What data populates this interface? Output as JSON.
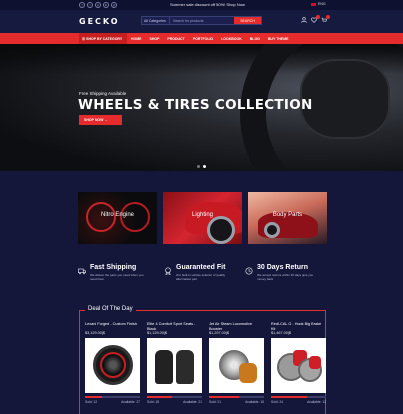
{
  "topbar": {
    "socials": [
      "f",
      "t",
      "p",
      "in",
      "yt"
    ],
    "promo": "Summer sale discount off 50%! Shop Now",
    "language": "ENG"
  },
  "header": {
    "logo": "GECKO",
    "search_category": "All Categories",
    "search_placeholder": "Search for products",
    "search_button": "SEARCH",
    "icons": [
      "user-icon",
      "heart-icon",
      "cart-icon"
    ]
  },
  "nav": {
    "shop_by_category": "☰ SHOP BY CATEGORY",
    "items": [
      "HOME",
      "SHOP",
      "PRODUCT",
      "PORTFOLIO",
      "LOOKBOOK",
      "BLOG",
      "BUY THEME"
    ]
  },
  "hero": {
    "subtitle": "Free Shipping Available",
    "title": "WHEELS & TIRES COLLECTION",
    "button": "SHOP NOW  →",
    "slides": 2,
    "active_slide": 1
  },
  "categories": [
    {
      "label": "Nitro Engine"
    },
    {
      "label": "Lighting"
    },
    {
      "label": "Body Parts"
    }
  ],
  "features": [
    {
      "icon": "truck-icon",
      "title": "Fast Shipping",
      "desc": "We deliver the parts you need when you need them."
    },
    {
      "icon": "badge-icon",
      "title": "Guaranteed Fit",
      "desc": "Our built-in vehicle selector of quality aftermarket part"
    },
    {
      "icon": "clock-icon",
      "title": "30 Days Return",
      "desc": "We accept returns within 30 days give you money back"
    }
  ],
  "deal": {
    "title": "Deal Of The Day",
    "products": [
      {
        "name": "Lexani Forged - Custom Finish",
        "price": "$3,129.00|$",
        "sold": "Sold: 12",
        "available": "Available: 27",
        "progress": 0.3
      },
      {
        "name": "Elite 4 Comfort Sport Seats - Black",
        "price": "$1,129.00|$",
        "sold": "Sold: 18",
        "available": "Available: 21",
        "progress": 0.45
      },
      {
        "name": "Jet Air Steam Locomotive Booster",
        "price": "$1,297.00|$",
        "sold": "Sold: 21",
        "available": "Available: 15",
        "progress": 0.55
      },
      {
        "name": "Redi-CAL G - Hook Big Brake Kit",
        "price": "$1,467.00|$",
        "sold": "Sold: 24",
        "available": "Available: 13",
        "progress": 0.65
      }
    ]
  },
  "colors": {
    "background": "#14163a",
    "accent": "#e52b2b"
  }
}
